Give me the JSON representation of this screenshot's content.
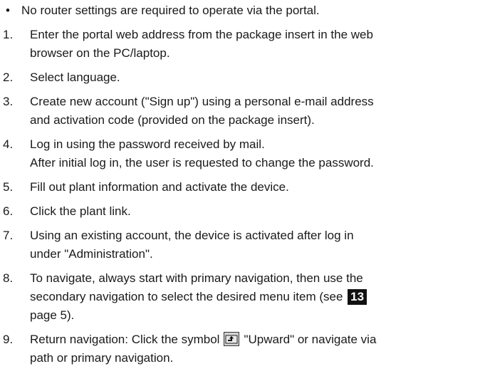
{
  "note": "No router settings are required to operate via the portal.",
  "steps": [
    {
      "num": "1.",
      "lines": [
        "Enter the portal web address from the package insert in the web",
        "browser on the PC/laptop."
      ]
    },
    {
      "num": "2.",
      "lines": [
        "Select language."
      ]
    },
    {
      "num": "3.",
      "lines": [
        "Create new account (\"Sign up\") using a personal e-mail address",
        "and activation code (provided on the package insert)."
      ]
    },
    {
      "num": "4.",
      "lines": [
        "Log in using the password received by mail.",
        "After initial log in, the user is requested to change the password."
      ]
    },
    {
      "num": "5.",
      "lines": [
        "Fill out plant information and activate the device."
      ]
    },
    {
      "num": "6.",
      "lines": [
        "Click the plant link."
      ]
    },
    {
      "num": "7.",
      "lines": [
        "Using an existing account, the device is activated after log in",
        "under \"Administration\"."
      ]
    },
    {
      "num": "8.",
      "line1": "To navigate, always start with primary navigation, then use the",
      "line2_before": "secondary navigation to select the desired menu item (see",
      "ref": "13",
      "line3": "page 5)."
    },
    {
      "num": "9.",
      "line1_before": "Return navigation: Click the symbol",
      "icon": "upward-folder-icon",
      "line1_after": "\"Upward\" or navigate via",
      "line2": "path or primary navigation."
    }
  ]
}
